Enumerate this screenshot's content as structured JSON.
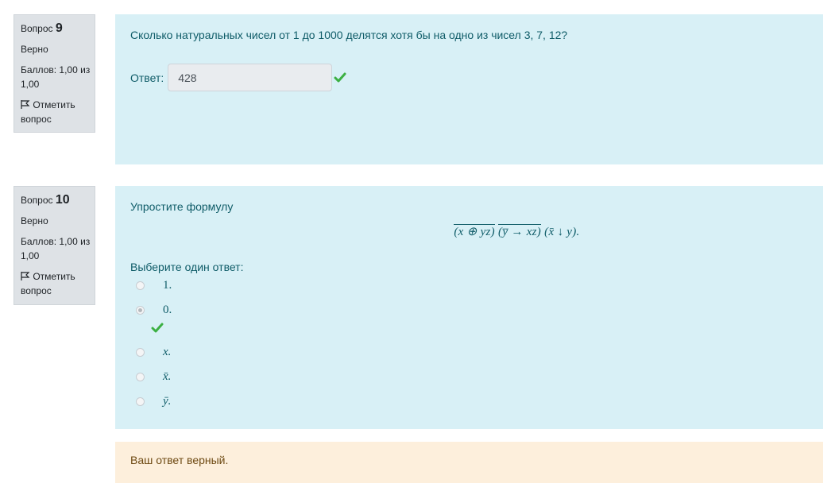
{
  "q9": {
    "label": "Вопрос",
    "number": "9",
    "state": "Верно",
    "grade": "Баллов: 1,00 из 1,00",
    "flag": "Отметить вопрос",
    "text": "Сколько натуральных чисел от 1 до 1000 делятся хотя бы на одно из чисел 3, 7, 12?",
    "answer_label": "Ответ:",
    "answer_value": "428"
  },
  "q10": {
    "label": "Вопрос",
    "number": "10",
    "state": "Верно",
    "grade": "Баллов: 1,00 из 1,00",
    "flag": "Отметить вопрос",
    "text": "Упростите формулу",
    "formula": {
      "part1": "(x ⊕ yz)",
      "part2": "(y̅ → xz)",
      "part3": "(x̄ ↓ y).",
      "full": "(x ⊕ yz) (y̅ → xz) (x̄ ↓ y)."
    },
    "prompt": "Выберите один ответ:",
    "options": [
      {
        "label": "1.",
        "checked": false
      },
      {
        "label": "0.",
        "checked": true
      },
      {
        "label": "x.",
        "checked": false
      },
      {
        "label": "x̄.",
        "checked": false
      },
      {
        "label": "ȳ.",
        "checked": false
      }
    ],
    "outcome": "Ваш ответ верный."
  },
  "colors": {
    "correct": "#3cb043",
    "formulation_bg": "#d8f0f6",
    "outcome_bg": "#fdefdc"
  },
  "icons": {
    "flag": "flag-icon",
    "check": "check-icon"
  }
}
